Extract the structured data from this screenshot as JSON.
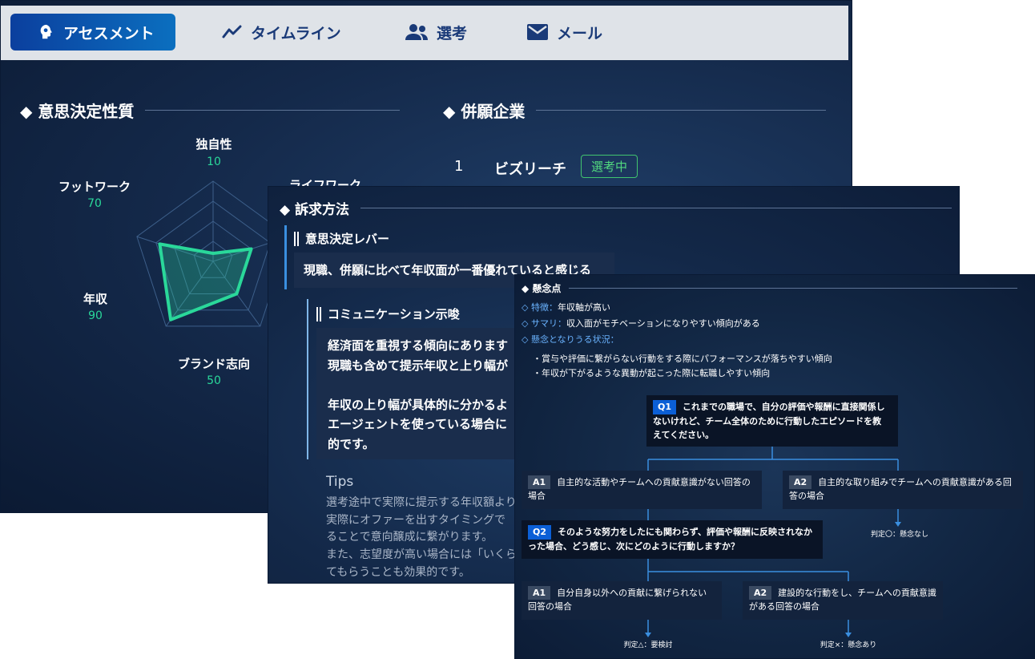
{
  "tabs": [
    {
      "label": "アセスメント",
      "icon": "brain-head-icon",
      "active": true
    },
    {
      "label": "タイムライン",
      "icon": "trend-line-icon",
      "active": false
    },
    {
      "label": "選考",
      "icon": "users-icon",
      "active": false
    },
    {
      "label": "メール",
      "icon": "mail-icon",
      "active": false
    }
  ],
  "decision": {
    "title": "◆ 意思決定性質",
    "axes": [
      {
        "label": "独自性",
        "value": "10"
      },
      {
        "label": "ライフワーク",
        "value": ""
      },
      {
        "label": "ブランド志向",
        "value": "50"
      },
      {
        "label": "年収",
        "value": "90"
      },
      {
        "label": "フットワーク",
        "value": "70"
      }
    ]
  },
  "companies": {
    "title": "◆ 併願企業",
    "items": [
      {
        "rank": "1",
        "name": "ビズリーチ",
        "status": "選考中"
      }
    ]
  },
  "appeal": {
    "title": "◆ 訴求方法",
    "lever_title": "意思決定レバー",
    "lever_text": "現職、併願に比べて年収面が一番優れていると感じる",
    "comm_title": "コミュニケーション示唆",
    "comm_lines": [
      "経済面を重視する傾向にあります",
      "現職も含めて提示年収と上り幅が",
      "",
      "年収の上り幅が具体的に分かるよ",
      "エージェントを使っている場合に",
      "的です。"
    ],
    "tips_title": "Tips",
    "tips_lines": [
      "選考途中で実際に提示する年収額より",
      "実際にオファーを出すタイミングで",
      "ることで意向醸成に繋がります。",
      "また、志望度が高い場合には「いくら",
      "てもらうことも効果的です。"
    ]
  },
  "concerns": {
    "title": "◆ 懸念点",
    "feature_key": "◇ 特徴：",
    "feature_val": "年収軸が高い",
    "summary_key": "◇ サマリ：",
    "summary_val": "収入面がモチベーションになりやすい傾向がある",
    "situation_key": "◇ 懸念となりうる状況：",
    "bullets": [
      "・賞与や評価に繋がらない行動をする際にパフォーマンスが落ちやすい傾向",
      "・年収が下がるような異動が起こった際に転職しやすい傾向"
    ],
    "q1": {
      "tag": "Q1",
      "text": "これまでの職場で、自分の評価や報酬に直接関係しないけれど、チーム全体のために行動したエピソードを教えてください。"
    },
    "q1_a1": {
      "tag": "A1",
      "text": "自主的な活動やチームへの貢献意識がない回答の場合"
    },
    "q1_a2": {
      "tag": "A2",
      "text": "自主的な取り組みでチームへの貢献意識がある回答の場合"
    },
    "judge_ok": "判定〇：懸念なし",
    "q2": {
      "tag": "Q2",
      "text": "そのような努力をしたにも関わらず、評価や報酬に反映されなかった場合、どう感じ、次にどのように行動しますか？"
    },
    "q2_a1": {
      "tag": "A1",
      "text": "自分自身以外への貢献に繋げられない回答の場合"
    },
    "q2_a2": {
      "tag": "A2",
      "text": "建設的な行動をし、チームへの貢献意識がある回答の場合"
    },
    "judge_tbd": "判定△：要検討",
    "judge_ng": "判定×：懸念あり"
  },
  "colors": {
    "accent": "#2ad89a",
    "tab_active": "#0b4fae",
    "badge": "#41c46f",
    "flow": "#3a8fe0"
  },
  "radar_data": {
    "values": [
      10,
      50,
      50,
      90,
      70
    ],
    "max": 100
  }
}
